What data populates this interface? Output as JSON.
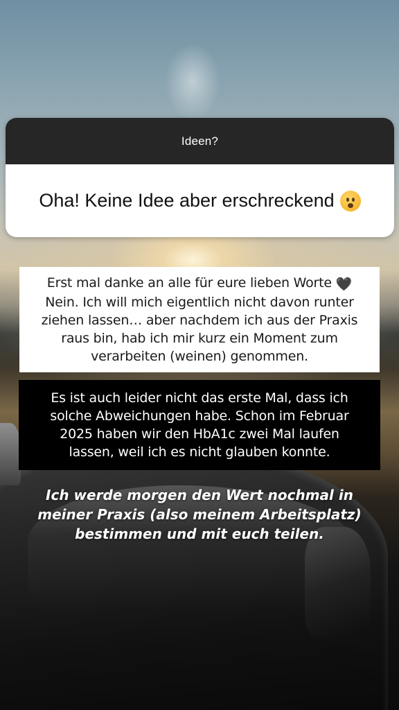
{
  "question_sticker": {
    "question": "Ideen?",
    "answer": "Oha! Keine Idee aber erschreckend",
    "answer_emoji": "worried-face-emoji"
  },
  "text_box_white": {
    "line_1": "Erst mal danke an alle für eure lieben Worte",
    "line_1_emoji": "🖤",
    "line_2": "Nein. Ich will mich eigentlich nicht davon runter",
    "line_3": "ziehen lassen… aber nachdem ich aus der Praxis",
    "line_4": "raus bin, hab ich mir kurz ein Moment zum",
    "line_5": "verarbeiten (weinen) genommen."
  },
  "text_box_black": {
    "line_1": "Es ist auch leider nicht das erste Mal, dass ich",
    "line_2": "solche Abweichungen habe. Schon im Februar",
    "line_3": "2025 haben wir den HbA1c zwei Mal laufen",
    "line_4": "lassen, weil ich es nicht glauben konnte."
  },
  "caption": {
    "line_1": "Ich werde morgen den Wert nochmal in",
    "line_2": "meiner Praxis (also meinem Arbeitsplatz)",
    "line_3": "bestimmen und mit euch teilen."
  },
  "colors": {
    "sticker_header": "#262626",
    "sticker_body": "#ffffff",
    "box_white": "#ffffff",
    "box_black": "#000000",
    "caption_text": "#ffffff"
  }
}
